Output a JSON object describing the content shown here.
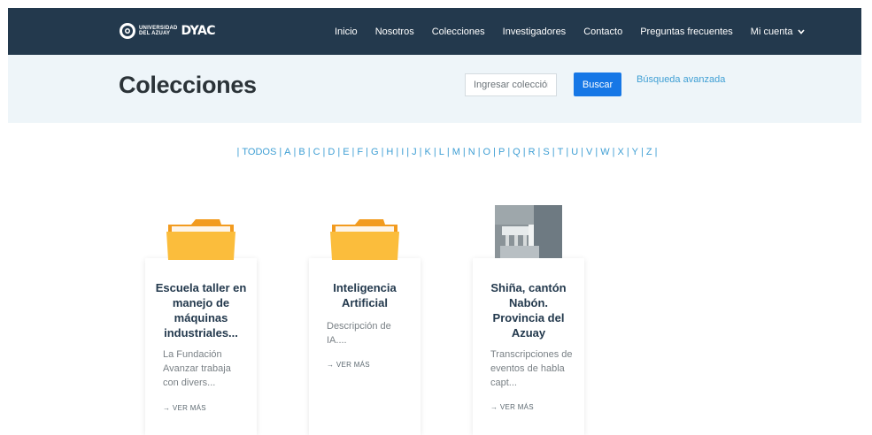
{
  "brand": {
    "university_line1": "UNIVERSIDAD",
    "university_line2": "DEL AZUAY",
    "name": "DYAC"
  },
  "nav": {
    "items": [
      "Inicio",
      "Nosotros",
      "Colecciones",
      "Investigadores",
      "Contacto",
      "Preguntas frecuentes"
    ],
    "account": "Mi cuenta"
  },
  "header": {
    "title": "Colecciones",
    "search_placeholder": "Ingresar colección",
    "search_button": "Buscar",
    "advanced_link": "Búsqueda avanzada"
  },
  "alphabet": [
    "TODOS",
    "A",
    "B",
    "C",
    "D",
    "E",
    "F",
    "G",
    "H",
    "I",
    "J",
    "K",
    "L",
    "M",
    "N",
    "O",
    "P",
    "Q",
    "R",
    "S",
    "T",
    "U",
    "V",
    "W",
    "X",
    "Y",
    "Z"
  ],
  "cards": [
    {
      "thumb": "folder-icon",
      "title": "Escuela taller en manejo de máquinas industriales...",
      "description": "La Fundación Avanzar trabaja con divers...",
      "more": "→ VER MÁS"
    },
    {
      "thumb": "folder-icon",
      "title": "Inteligencia Artificial",
      "description": "Descripción de IA....",
      "more": "→ VER MÁS"
    },
    {
      "thumb": "photo-thumbnail",
      "title": "Shiña, cantón Nabón. Provincia del Azuay",
      "description": "Transcripciones de eventos de habla capt...",
      "more": "→ VER MÁS"
    }
  ],
  "colors": {
    "navbar": "#23394d",
    "header_band": "#eef5f9",
    "accent_link": "#3f9fd4",
    "button": "#1677e6",
    "folder": "#f9b531"
  }
}
